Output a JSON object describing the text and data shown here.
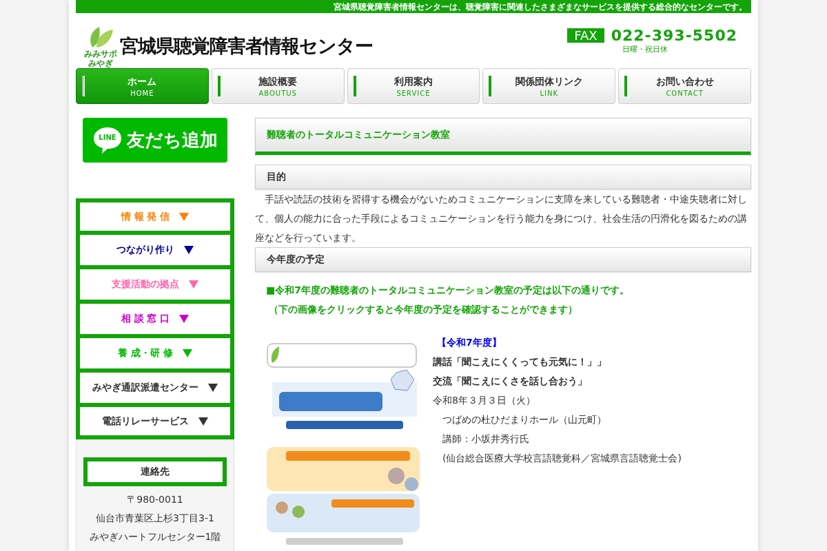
{
  "top_bar": {
    "tagline": "宮城県聴覚障害者情報センターは、聴覚障害に関連したさまざまなサービスを提供する総合的なセンターです。"
  },
  "header": {
    "logo_caption": [
      "みみサポ",
      "みやぎ"
    ],
    "site_title": "宮城県聴覚障害者情報センター",
    "fax_label": "FAX",
    "fax_number": "022-393-5502",
    "fax_note": "日曜・祝日休"
  },
  "nav": [
    {
      "label": "ホーム",
      "sublabel": "HOME",
      "selected": true
    },
    {
      "label": "施設概要",
      "sublabel": "ABOUTUS",
      "selected": false
    },
    {
      "label": "利用案内",
      "sublabel": "SERVICE",
      "selected": false
    },
    {
      "label": "関係団体リンク",
      "sublabel": "LINK",
      "selected": false
    },
    {
      "label": "お問い合わせ",
      "sublabel": "CONTACT",
      "selected": false
    }
  ],
  "line_button": {
    "badge": "LINE",
    "label": "友だち追加"
  },
  "side_menu": [
    {
      "label": "情 報 発 信",
      "color": "#ff7f00"
    },
    {
      "label": "つながり作り",
      "color": "#000099"
    },
    {
      "label": "支援活動の拠点",
      "color": "#ff66aa"
    },
    {
      "label": "相 談 窓 口",
      "color": "#cc00cc"
    },
    {
      "label": "養 成・研 修",
      "color": "#00bb00"
    },
    {
      "label": "みやぎ通訳派遣センター",
      "color": "#333333"
    },
    {
      "label": "電話リレーサービス",
      "color": "#333333"
    }
  ],
  "contact": {
    "title": "連絡先",
    "lines": [
      "〒980-0011",
      "仙台市青葉区上杉3丁目3-1",
      "みやぎハートフルセンター1階"
    ]
  },
  "content": {
    "page_title": "難聴者のトータルコミュニケーション教室",
    "purpose": {
      "heading": "目的",
      "paragraph": "手話や読話の技術を習得する機会がないためコミュニケーションに支障を来している難聴者・中途失聴者に対して、個人の能力に合った手段によるコミュニケーションを行う能力を身につけ、社会生活の円滑化を図るための講座などを行っています。"
    },
    "schedule": {
      "heading": "今年度の予定",
      "notices": [
        "■令和7年度の難聴者のトータルコミュニケーション教室の予定は以下の通りです。",
        "（下の画像をクリックすると今年度の予定を確認することができます）"
      ],
      "flyer": {
        "kind": "picture"
      },
      "details": [
        {
          "kind": "year",
          "text": "【令和7年度】"
        },
        {
          "kind": "bold",
          "text": "講話「聞こえにくくっても元気に！」」"
        },
        {
          "kind": "bold",
          "text": "交流「聞こえにくさを話し合おう」"
        },
        {
          "kind": "plain",
          "text": "令和8年３月３日（火）"
        },
        {
          "kind": "indented",
          "text": "つばめの杜ひだまりホール（山元町）"
        },
        {
          "kind": "indented",
          "text": "講師：小坂井秀行氏"
        },
        {
          "kind": "indented",
          "text": "(仙台総合医療大学校言語聴覚科／宮城県言語聴覚士会)"
        }
      ]
    }
  }
}
